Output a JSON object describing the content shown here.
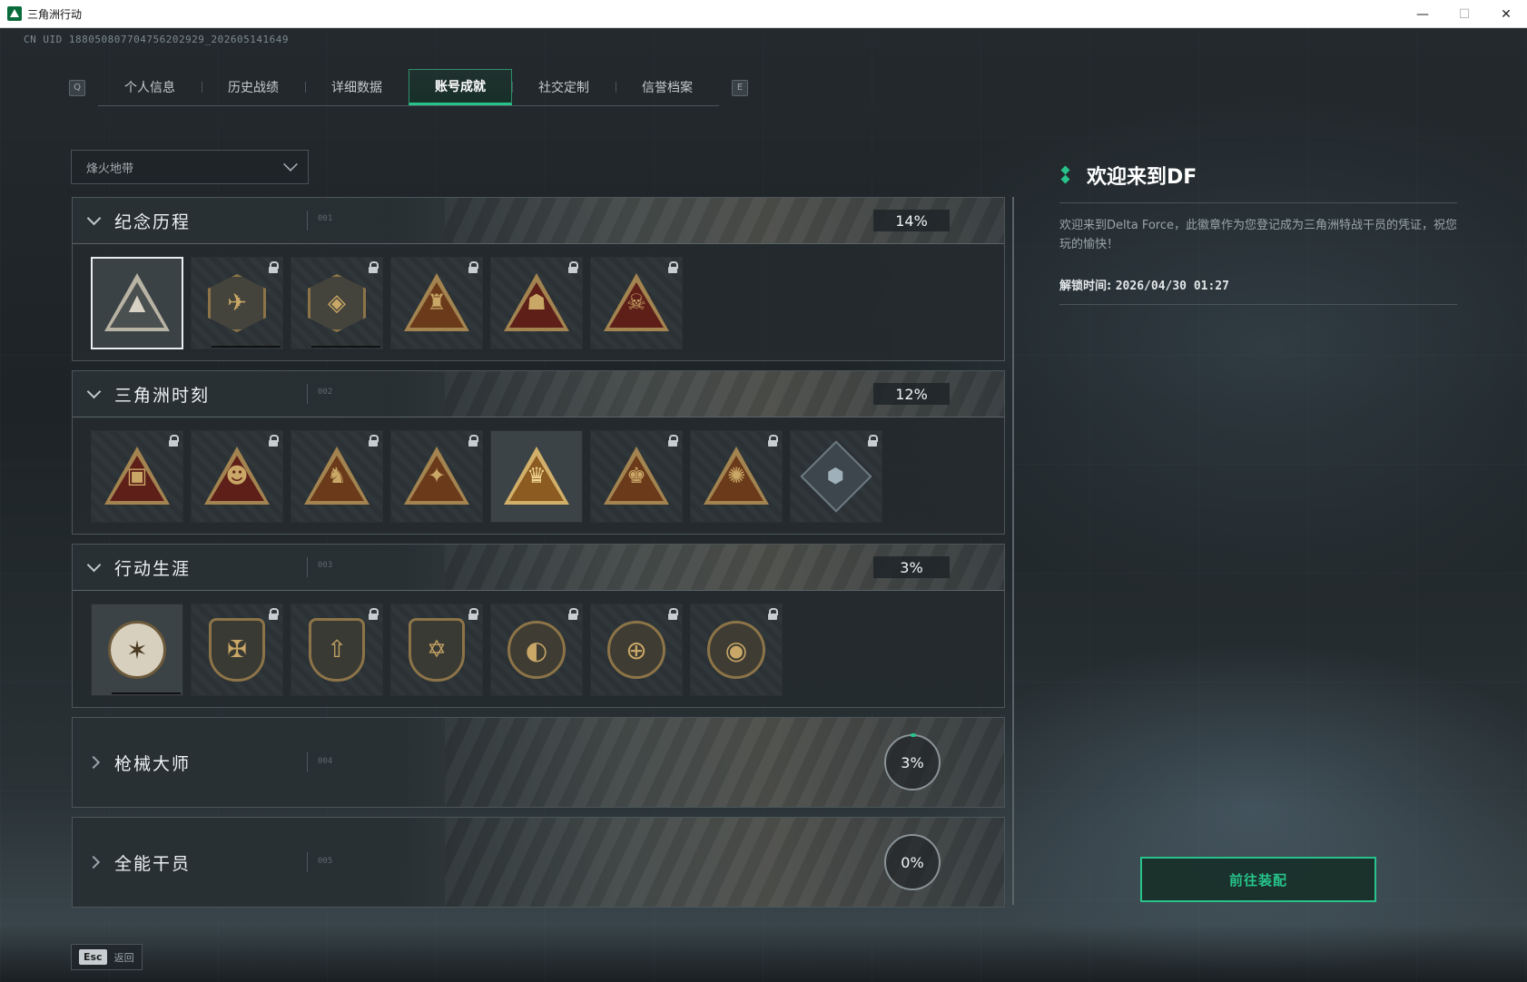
{
  "window": {
    "title": "三角洲行动"
  },
  "uid": "CN UID 188050807704756202929_202605141649",
  "tabs": {
    "left_key": "Q",
    "right_key": "E",
    "items": [
      {
        "label": "个人信息"
      },
      {
        "label": "历史战绩"
      },
      {
        "label": "详细数据"
      },
      {
        "label": "账号成就",
        "active": true
      },
      {
        "label": "社交定制"
      },
      {
        "label": "信誉档案"
      }
    ]
  },
  "filter": {
    "selected": "烽火地带"
  },
  "categories": [
    {
      "title": "纪念历程",
      "num": "001",
      "percent": "14%",
      "expanded": true,
      "badges": [
        {
          "name": "欢迎来到DF",
          "icon": "triangle-emblem",
          "locked": false,
          "selected": true
        },
        {
          "name": "helicopter",
          "icon": "helicopter-emblem",
          "locked": true
        },
        {
          "name": "shield",
          "icon": "shield-emblem",
          "locked": true
        },
        {
          "name": "robot",
          "icon": "robot-emblem",
          "locked": true
        },
        {
          "name": "operator",
          "icon": "operator-emblem",
          "locked": true
        },
        {
          "name": "skull",
          "icon": "skull-emblem",
          "locked": true
        }
      ]
    },
    {
      "title": "三角洲时刻",
      "num": "002",
      "percent": "12%",
      "expanded": true,
      "badges": [
        {
          "icon": "box-emblem",
          "locked": true
        },
        {
          "icon": "mask-emblem",
          "locked": true
        },
        {
          "icon": "runner-emblem",
          "locked": true
        },
        {
          "icon": "hands-emblem",
          "locked": true
        },
        {
          "icon": "team-emblem",
          "locked": false
        },
        {
          "icon": "crowd-emblem",
          "locked": true
        },
        {
          "icon": "fish-emblem",
          "locked": true
        },
        {
          "icon": "cube-emblem",
          "locked": true
        }
      ]
    },
    {
      "title": "行动生涯",
      "num": "003",
      "percent": "3%",
      "expanded": true,
      "badges": [
        {
          "icon": "star-emblem",
          "locked": false
        },
        {
          "icon": "eagle-emblem",
          "locked": true
        },
        {
          "icon": "arrow-emblem",
          "locked": true
        },
        {
          "icon": "hexagon-emblem",
          "locked": true
        },
        {
          "icon": "helmet-emblem",
          "locked": true
        },
        {
          "icon": "crosshair-emblem",
          "locked": true
        },
        {
          "icon": "eye-emblem",
          "locked": true
        }
      ]
    },
    {
      "title": "枪械大师",
      "num": "004",
      "percent": "3%",
      "expanded": false
    },
    {
      "title": "全能干员",
      "num": "005",
      "percent": "0%",
      "expanded": false
    }
  ],
  "detail": {
    "title": "欢迎来到DF",
    "description": "欢迎来到Delta Force，此徽章作为您登记成为三角洲特战干员的凭证，祝您玩的愉快！",
    "unlock_label": "解锁时间: ",
    "unlock_time": "2026/04/30 01:27"
  },
  "equip_button": "前往装配",
  "footer": {
    "key": "Esc",
    "label": "返回"
  },
  "colors": {
    "accent": "#27c38a"
  }
}
